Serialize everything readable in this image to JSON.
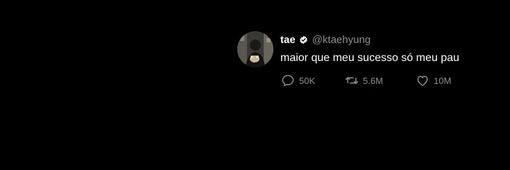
{
  "tweet": {
    "display_name": "tae",
    "handle": "@ktaehyung",
    "verified": true,
    "text": "maior que meu sucesso só meu pau",
    "stats": {
      "replies": "50K",
      "retweets": "5.6M",
      "likes": "10M"
    }
  },
  "icons": {
    "verified": "verified-badge-icon",
    "reply": "reply-icon",
    "retweet": "retweet-icon",
    "like": "heart-icon"
  },
  "colors": {
    "background": "#000000",
    "primary_text": "#ffffff",
    "secondary_text": "#8b8f94"
  }
}
